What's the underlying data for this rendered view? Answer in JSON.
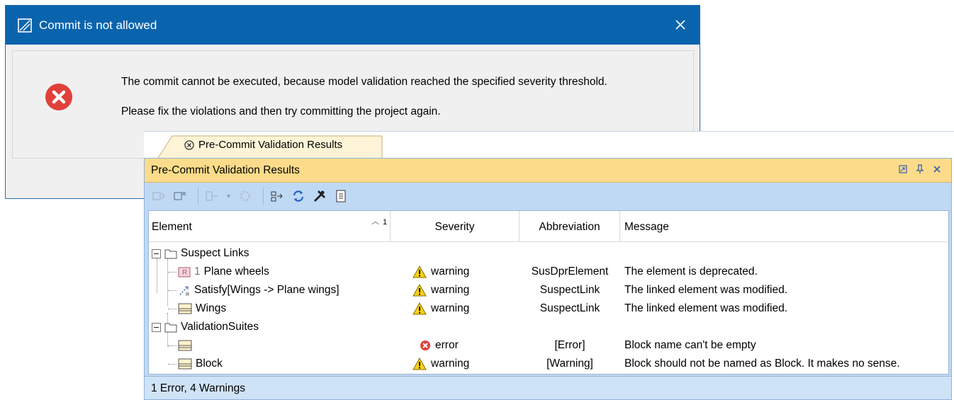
{
  "dialog": {
    "title": "Commit is not allowed",
    "message_line1": "The commit cannot be executed, because model validation reached the specified severity threshold.",
    "message_line2": "Please fix the violations and then try committing the project again."
  },
  "tab": {
    "label": "Pre-Commit Validation Results"
  },
  "panel": {
    "title": "Pre-Commit Validation Results"
  },
  "table": {
    "sort_indicator": "1",
    "columns": [
      "Element",
      "Severity",
      "Abbreviation",
      "Message"
    ],
    "groups": [
      {
        "label": "Suspect Links"
      },
      {
        "label": "ValidationSuites"
      }
    ],
    "rows": [
      {
        "number": "1",
        "element": "Plane wheels",
        "severity": "warning",
        "abbreviation": "SusDprElement",
        "message": "The element is deprecated."
      },
      {
        "element": "Satisfy[Wings -> Plane wings]",
        "severity": "warning",
        "abbreviation": "SuspectLink",
        "message": "The linked element was modified."
      },
      {
        "element": "Wings",
        "severity": "warning",
        "abbreviation": "SuspectLink",
        "message": "The linked element was modified."
      },
      {
        "element": "",
        "severity": "error",
        "abbreviation": "[Error]",
        "message": "Block name can't be empty"
      },
      {
        "element": "Block",
        "severity": "warning",
        "abbreviation": "[Warning]",
        "message": "Block should not be named as Block. It makes no sense."
      }
    ]
  },
  "status": "1 Error, 4 Warnings",
  "colors": {
    "title_bar": "#0a64ad",
    "panel_header": "#fcdc8a",
    "panel_bg": "#bfd9f4",
    "error_red": "#e0403a",
    "warning_yellow": "#f7d117"
  }
}
